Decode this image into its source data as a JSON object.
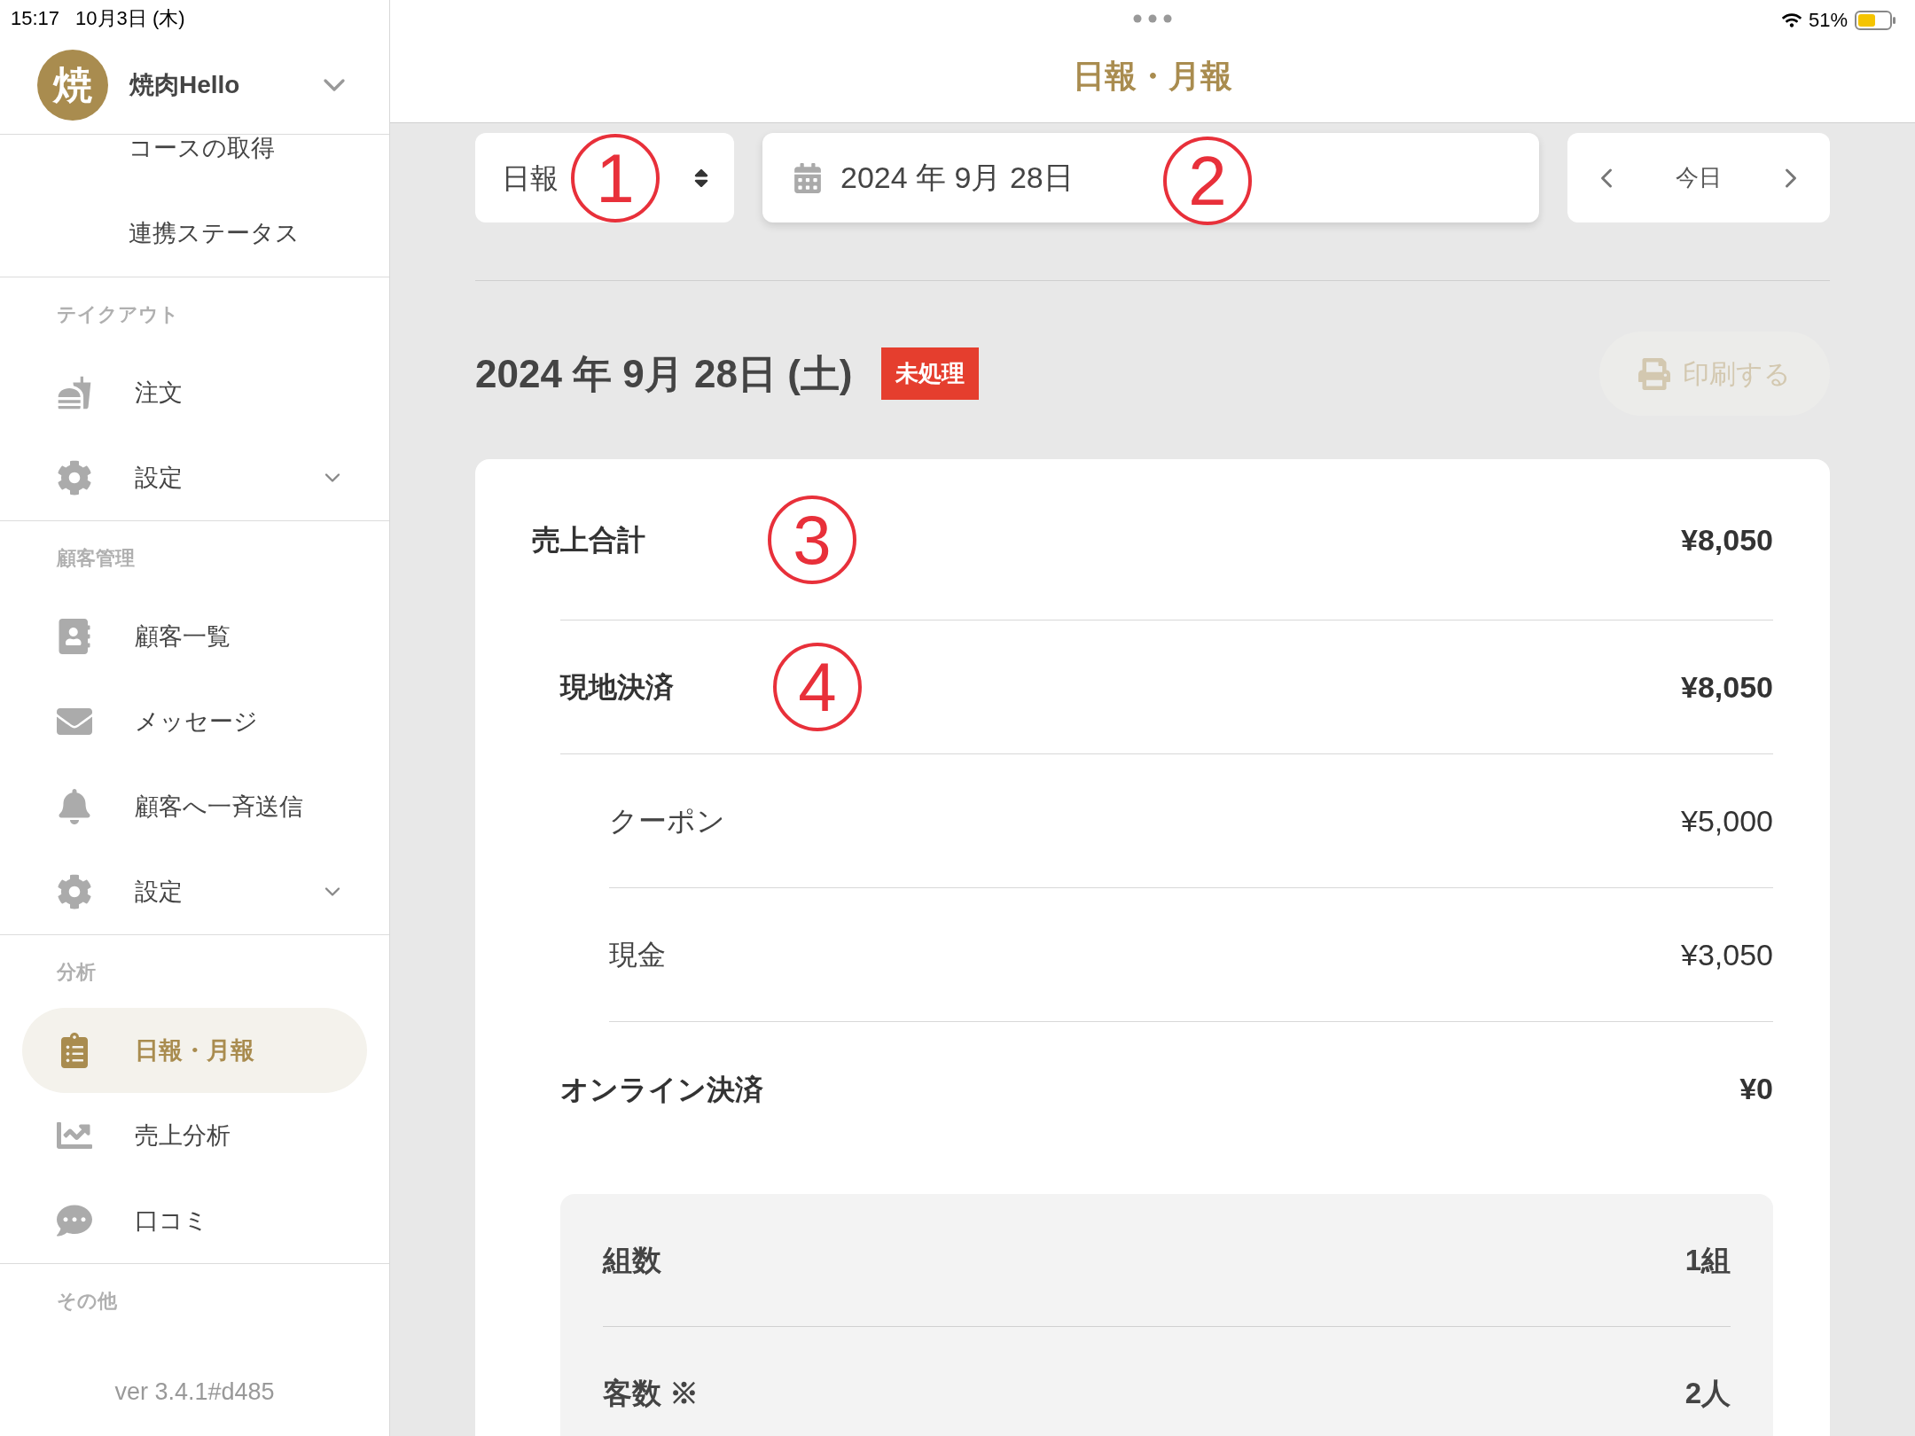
{
  "status_bar": {
    "time": "15:17",
    "date": "10月3日 (木)",
    "battery": "51%"
  },
  "sidebar": {
    "account": {
      "avatar": "焼",
      "name": "焼肉Hello"
    },
    "top_items": [
      "コースの取得",
      "連携ステータス"
    ],
    "sections": [
      {
        "title": "テイクアウト",
        "items": [
          {
            "label": "注文",
            "kind": "order",
            "expandable": false,
            "selected": false
          },
          {
            "label": "設定",
            "kind": "settings",
            "expandable": true,
            "selected": false
          }
        ]
      },
      {
        "title": "顧客管理",
        "items": [
          {
            "label": "顧客一覧",
            "kind": "contacts",
            "expandable": false,
            "selected": false
          },
          {
            "label": "メッセージ",
            "kind": "message",
            "expandable": false,
            "selected": false
          },
          {
            "label": "顧客へ一斉送信",
            "kind": "bell",
            "expandable": false,
            "selected": false
          },
          {
            "label": "設定",
            "kind": "settings",
            "expandable": true,
            "selected": false
          }
        ]
      },
      {
        "title": "分析",
        "items": [
          {
            "label": "日報・月報",
            "kind": "report",
            "expandable": false,
            "selected": true
          },
          {
            "label": "売上分析",
            "kind": "chart",
            "expandable": false,
            "selected": false
          },
          {
            "label": "口コミ",
            "kind": "chat",
            "expandable": false,
            "selected": false
          }
        ]
      },
      {
        "title": "その他"
      }
    ],
    "version": "ver 3.4.1#d485"
  },
  "header": {
    "title": "日報・月報"
  },
  "toolbar": {
    "mode_select": {
      "value": "日報",
      "annotation": "1"
    },
    "date_field": {
      "value": "2024 年 9月 28日",
      "annotation": "2"
    },
    "nav": {
      "label": "今日"
    }
  },
  "report": {
    "date": "2024 年 9月 28日 (土)",
    "badge": "未処理",
    "print_button": {
      "label": "印刷する",
      "disabled": true
    },
    "rows": [
      {
        "kind": "total",
        "label": "売上合計",
        "value": "¥8,050",
        "annotation": "3"
      },
      {
        "kind": "group",
        "label": "現地決済",
        "value": "¥8,050",
        "annotation": "4"
      },
      {
        "kind": "sub",
        "label": "クーポン",
        "value": "¥5,000"
      },
      {
        "kind": "sub",
        "label": "現金",
        "value": "¥3,050"
      },
      {
        "kind": "group",
        "label": "オンライン決済",
        "value": "¥0"
      }
    ],
    "stats": [
      {
        "label": "組数",
        "value": "1組"
      },
      {
        "label": "客数 ※",
        "value": "2人"
      }
    ]
  }
}
